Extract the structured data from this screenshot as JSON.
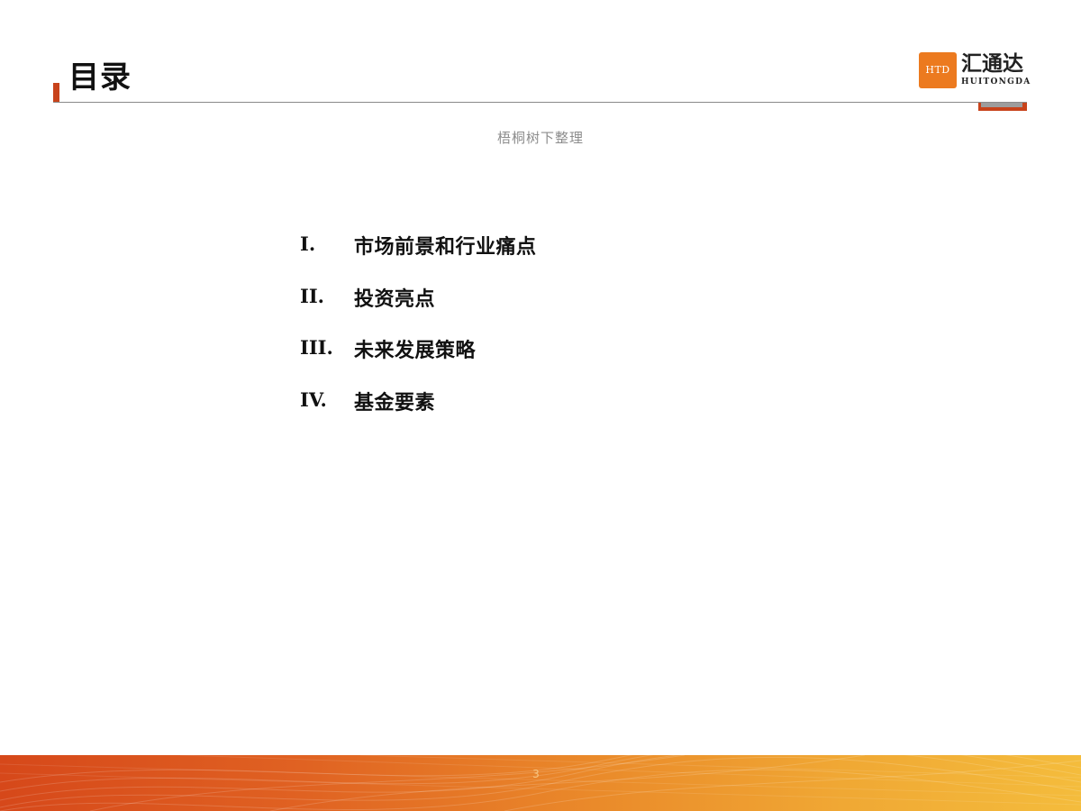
{
  "header": {
    "title": "目录"
  },
  "logo": {
    "badge": "HTD",
    "name_cn": "汇通达",
    "name_en": "HUITONGDA"
  },
  "subtitle": "梧桐树下整理",
  "toc": {
    "items": [
      {
        "numeral": "I.",
        "label": "市场前景和行业痛点"
      },
      {
        "numeral": "II.",
        "label": "投资亮点"
      },
      {
        "numeral": "III.",
        "label": "未来发展策略"
      },
      {
        "numeral": "IV.",
        "label": "基金要素"
      }
    ]
  },
  "footer": {
    "page_number": "3"
  },
  "colors": {
    "accent": "#c8431b",
    "logo_orange": "#ec7a1f",
    "band_start": "#d6481a",
    "band_end": "#f4bc3c"
  }
}
